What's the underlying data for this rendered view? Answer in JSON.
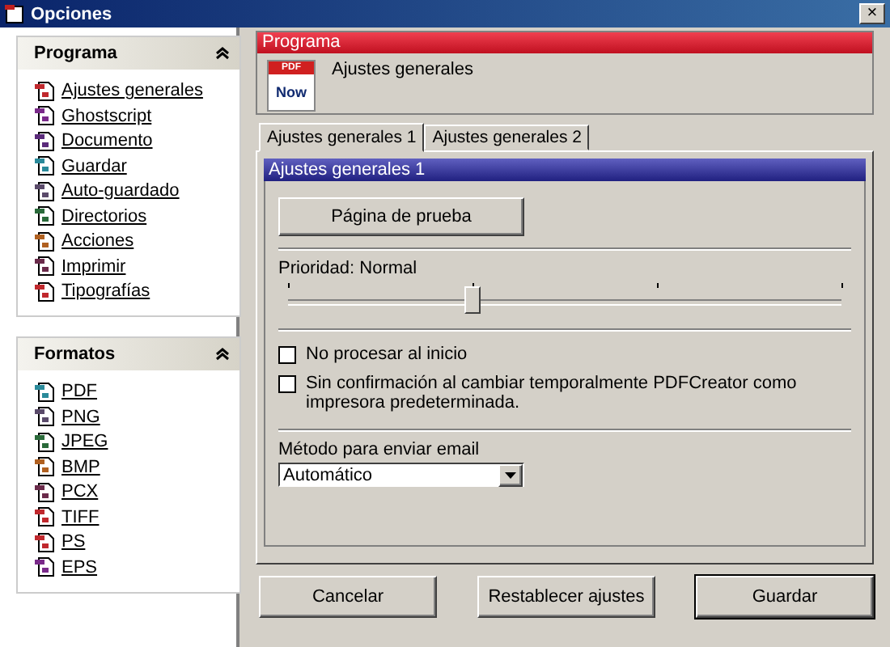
{
  "window": {
    "title": "Opciones",
    "close": "×"
  },
  "sidebar": {
    "groups": [
      {
        "title": "Programa",
        "items": [
          "Ajustes generales",
          "Ghostscript",
          "Documento",
          "Guardar",
          "Auto-guardado",
          "Directorios",
          "Acciones",
          "Imprimir",
          "Tipografías"
        ]
      },
      {
        "title": "Formatos",
        "items": [
          "PDF",
          "PNG",
          "JPEG",
          "BMP",
          "PCX",
          "TIFF",
          "PS",
          "EPS"
        ]
      }
    ]
  },
  "header": {
    "title": "Programa",
    "subtitle": "Ajustes generales",
    "logo_top": "PDF",
    "logo_bottom": "Now"
  },
  "tabs": [
    {
      "label": "Ajustes generales 1",
      "selected": true
    },
    {
      "label": "Ajustes generales 2",
      "selected": false
    }
  ],
  "panel": {
    "title": "Ajustes generales 1",
    "test_button": "Página de prueba",
    "priority": {
      "label": "Prioridad: Normal",
      "level": 0.3333
    },
    "checkboxes": [
      {
        "label": "No procesar al inicio",
        "checked": false
      },
      {
        "label": "Sin confirmación al cambiar temporalmente PDFCreator como impresora predeterminada.",
        "checked": false
      }
    ],
    "email": {
      "label": "Método para enviar email",
      "value": "Automático"
    }
  },
  "buttons": [
    {
      "label": "Cancelar",
      "default": false
    },
    {
      "label": "Restablecer ajustes",
      "default": false
    },
    {
      "label": "Guardar",
      "default": true
    }
  ]
}
